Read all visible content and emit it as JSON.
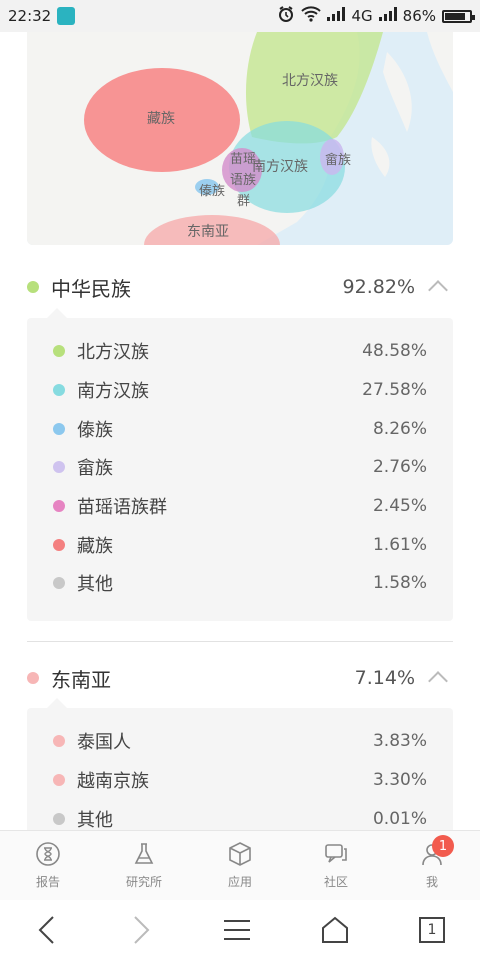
{
  "status": {
    "time": "22:32",
    "network": "4G",
    "battery": "86%",
    "battery_level": 0.86
  },
  "map": {
    "regions": [
      {
        "label": "藏族",
        "color": "#f77c7c"
      },
      {
        "label": "北方汉族",
        "color": "#c2e58a"
      },
      {
        "label": "南方汉族",
        "color": "#86dbe0"
      },
      {
        "label": "苗瑶语族群",
        "color": "#d38ccb"
      },
      {
        "label": "傣族",
        "color": "#8cc8ee"
      },
      {
        "label": "畲族",
        "color": "#c9b8ee"
      },
      {
        "label": "东南亚",
        "color": "#f7a8a8"
      }
    ]
  },
  "groups": [
    {
      "name": "中华民族",
      "percent": "92.82%",
      "color": "#b7e07c",
      "items": [
        {
          "label": "北方汉族",
          "value": "48.58%",
          "color": "#b7e07c"
        },
        {
          "label": "南方汉族",
          "value": "27.58%",
          "color": "#86dbe0"
        },
        {
          "label": "傣族",
          "value": "8.26%",
          "color": "#8cc8ee"
        },
        {
          "label": "畲族",
          "value": "2.76%",
          "color": "#cfc3ef"
        },
        {
          "label": "苗瑶语族群",
          "value": "2.45%",
          "color": "#e684c2"
        },
        {
          "label": "藏族",
          "value": "1.61%",
          "color": "#f48080"
        },
        {
          "label": "其他",
          "value": "1.58%",
          "color": "#c8c8c8"
        }
      ]
    },
    {
      "name": "东南亚",
      "percent": "7.14%",
      "color": "#f7b6b6",
      "items": [
        {
          "label": "泰国人",
          "value": "3.83%",
          "color": "#f7b6b6"
        },
        {
          "label": "越南京族",
          "value": "3.30%",
          "color": "#f7b6b6"
        },
        {
          "label": "其他",
          "value": "0.01%",
          "color": "#c8c8c8"
        }
      ]
    }
  ],
  "tabs": [
    {
      "label": "报告",
      "icon": "hourglass-icon"
    },
    {
      "label": "研究所",
      "icon": "flask-icon"
    },
    {
      "label": "应用",
      "icon": "cube-icon"
    },
    {
      "label": "社区",
      "icon": "chat-icon"
    },
    {
      "label": "我",
      "icon": "person-icon",
      "badge": "1"
    }
  ],
  "nav": {
    "page_count": "1"
  }
}
